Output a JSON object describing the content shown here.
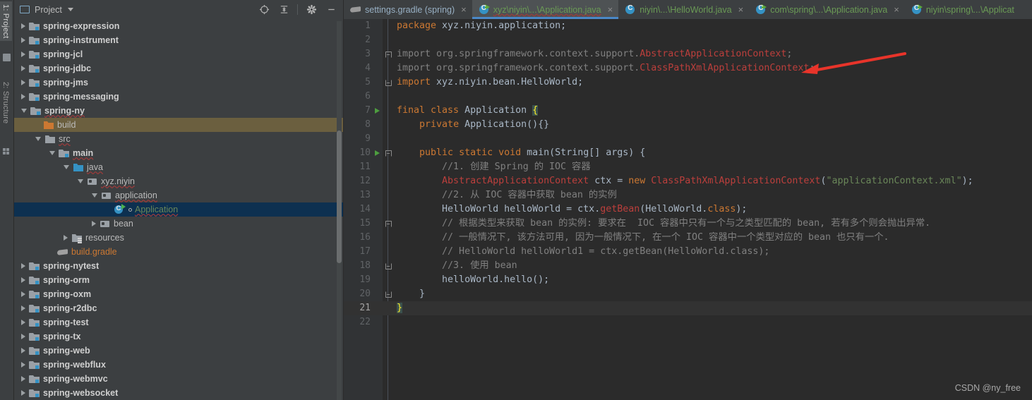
{
  "tool_strip": {
    "tabs": [
      {
        "label": "1: Project",
        "active": true
      },
      {
        "label": "2: Structure",
        "active": false
      }
    ]
  },
  "project_panel": {
    "title": "Project",
    "icons": [
      "monitor-icon",
      "chevron-down-icon",
      "locate-icon",
      "collapse-all-icon",
      "gear-icon",
      "minimize-icon"
    ],
    "tree": [
      {
        "label": "spring-expression",
        "indent": 1,
        "twist": "closed",
        "icon": "module-folder-icon",
        "style": "bold"
      },
      {
        "label": "spring-instrument",
        "indent": 1,
        "twist": "closed",
        "icon": "module-folder-icon",
        "style": "bold"
      },
      {
        "label": "spring-jcl",
        "indent": 1,
        "twist": "closed",
        "icon": "module-folder-icon",
        "style": "bold"
      },
      {
        "label": "spring-jdbc",
        "indent": 1,
        "twist": "closed",
        "icon": "module-folder-icon",
        "style": "bold"
      },
      {
        "label": "spring-jms",
        "indent": 1,
        "twist": "closed",
        "icon": "module-folder-icon",
        "style": "bold"
      },
      {
        "label": "spring-messaging",
        "indent": 1,
        "twist": "closed",
        "icon": "module-folder-icon",
        "style": "bold"
      },
      {
        "label": "spring-ny",
        "indent": 1,
        "twist": "open",
        "icon": "module-folder-icon",
        "style": "bold-squiggle"
      },
      {
        "label": "build",
        "indent": 2,
        "twist": "none",
        "icon": "orange-folder-icon",
        "style": "plain",
        "row_highlight": "build"
      },
      {
        "label": "src",
        "indent": 2,
        "twist": "open",
        "icon": "folder-icon",
        "style": "squiggle"
      },
      {
        "label": "main",
        "indent": 3,
        "twist": "open",
        "icon": "module-folder-icon",
        "style": "bold-squiggle"
      },
      {
        "label": "java",
        "indent": 4,
        "twist": "open",
        "icon": "blue-folder-icon",
        "style": "squiggle"
      },
      {
        "label": "xyz.niyin",
        "indent": 5,
        "twist": "open",
        "icon": "package-icon",
        "style": "squiggle"
      },
      {
        "label": "application",
        "indent": 6,
        "twist": "open",
        "icon": "package-icon",
        "style": "squiggle"
      },
      {
        "label": "Application",
        "indent": 7,
        "twist": "none",
        "icon": "java-class-run-icon",
        "style": "green-squiggle",
        "row_highlight": "selected"
      },
      {
        "label": "bean",
        "indent": 6,
        "twist": "closed",
        "icon": "package-icon",
        "style": "plain"
      },
      {
        "label": "resources",
        "indent": 4,
        "twist": "closed",
        "icon": "resources-folder-icon",
        "style": "plain"
      },
      {
        "label": "build.gradle",
        "indent": 3,
        "twist": "none",
        "icon": "gradle-icon",
        "style": "orange"
      },
      {
        "label": "spring-nytest",
        "indent": 1,
        "twist": "closed",
        "icon": "module-folder-icon",
        "style": "bold"
      },
      {
        "label": "spring-orm",
        "indent": 1,
        "twist": "closed",
        "icon": "module-folder-icon",
        "style": "bold"
      },
      {
        "label": "spring-oxm",
        "indent": 1,
        "twist": "closed",
        "icon": "module-folder-icon",
        "style": "bold"
      },
      {
        "label": "spring-r2dbc",
        "indent": 1,
        "twist": "closed",
        "icon": "module-folder-icon",
        "style": "bold"
      },
      {
        "label": "spring-test",
        "indent": 1,
        "twist": "closed",
        "icon": "module-folder-icon",
        "style": "bold"
      },
      {
        "label": "spring-tx",
        "indent": 1,
        "twist": "closed",
        "icon": "module-folder-icon",
        "style": "bold"
      },
      {
        "label": "spring-web",
        "indent": 1,
        "twist": "closed",
        "icon": "module-folder-icon",
        "style": "bold"
      },
      {
        "label": "spring-webflux",
        "indent": 1,
        "twist": "closed",
        "icon": "module-folder-icon",
        "style": "bold"
      },
      {
        "label": "spring-webmvc",
        "indent": 1,
        "twist": "closed",
        "icon": "module-folder-icon",
        "style": "bold"
      },
      {
        "label": "spring-websocket",
        "indent": 1,
        "twist": "closed",
        "icon": "module-folder-icon",
        "style": "bold"
      }
    ]
  },
  "editor_tabs": [
    {
      "label": "settings.gradle (spring)",
      "icon": "gradle-icon",
      "active": false,
      "color": "blue",
      "close": "×"
    },
    {
      "label": "xyz\\niyin\\...\\Application.java",
      "icon": "java-class-run-icon",
      "active": true,
      "color": "green",
      "wavy": true,
      "close": "×"
    },
    {
      "label": "niyin\\...\\HelloWorld.java",
      "icon": "java-class-icon",
      "active": false,
      "color": "green",
      "close": "×"
    },
    {
      "label": "com\\spring\\...\\Application.java",
      "icon": "java-class-run-icon",
      "active": false,
      "color": "green",
      "close": "×"
    },
    {
      "label": "niyin\\spring\\...\\Applicat",
      "icon": "java-class-run-icon",
      "active": false,
      "color": "green",
      "close": ""
    }
  ],
  "code": {
    "lines": [
      {
        "n": "1",
        "gutter_run": false,
        "fold": "",
        "tokens": [
          {
            "t": "package ",
            "c": "kw"
          },
          {
            "t": "xyz.niyin.application;",
            "c": "plain"
          }
        ]
      },
      {
        "n": "2",
        "gutter_run": false,
        "fold": "",
        "tokens": []
      },
      {
        "n": "3",
        "gutter_run": false,
        "fold": "top",
        "tokens": [
          {
            "t": "import ",
            "c": "cm"
          },
          {
            "t": "org.springframework.context.support.",
            "c": "cm"
          },
          {
            "t": "AbstractApplicationContext",
            "c": "err"
          },
          {
            "t": ";",
            "c": "cm"
          }
        ]
      },
      {
        "n": "4",
        "gutter_run": false,
        "fold": "",
        "tokens": [
          {
            "t": "import ",
            "c": "cm"
          },
          {
            "t": "org.springframework.context.support.",
            "c": "cm"
          },
          {
            "t": "ClassPathXmlApplicationContext",
            "c": "err"
          },
          {
            "t": ";",
            "c": "cm"
          }
        ]
      },
      {
        "n": "5",
        "gutter_run": false,
        "fold": "bot",
        "tokens": [
          {
            "t": "import ",
            "c": "kw"
          },
          {
            "t": "xyz.niyin.bean.HelloWorld;",
            "c": "plain"
          }
        ]
      },
      {
        "n": "6",
        "gutter_run": false,
        "fold": "",
        "tokens": []
      },
      {
        "n": "7",
        "gutter_run": true,
        "fold": "",
        "tokens": [
          {
            "t": "final class ",
            "c": "kw"
          },
          {
            "t": "Application ",
            "c": "cls2"
          },
          {
            "t": "{",
            "c": "brace-hl"
          }
        ]
      },
      {
        "n": "8",
        "gutter_run": false,
        "fold": "",
        "tokens": [
          {
            "t": "    ",
            "c": "plain"
          },
          {
            "t": "private ",
            "c": "kw"
          },
          {
            "t": "Application(){}",
            "c": "cls2"
          }
        ]
      },
      {
        "n": "9",
        "gutter_run": false,
        "fold": "",
        "tokens": []
      },
      {
        "n": "10",
        "gutter_run": true,
        "fold": "top",
        "tokens": [
          {
            "t": "    ",
            "c": "plain"
          },
          {
            "t": "public static void ",
            "c": "kw"
          },
          {
            "t": "main",
            "c": "mth2"
          },
          {
            "t": "(String[] args) {",
            "c": "cls2"
          }
        ]
      },
      {
        "n": "11",
        "gutter_run": false,
        "fold": "",
        "tokens": [
          {
            "t": "        //1. 创建 Spring 的 IOC 容器",
            "c": "cm"
          }
        ]
      },
      {
        "n": "12",
        "gutter_run": false,
        "fold": "",
        "tokens": [
          {
            "t": "        ",
            "c": "plain"
          },
          {
            "t": "AbstractApplicationContext",
            "c": "err"
          },
          {
            "t": " ctx = ",
            "c": "cls2"
          },
          {
            "t": "new ",
            "c": "kw"
          },
          {
            "t": "ClassPathXmlApplicationContext",
            "c": "err"
          },
          {
            "t": "(",
            "c": "cls2"
          },
          {
            "t": "\"applicationContext.xml\"",
            "c": "str"
          },
          {
            "t": ");",
            "c": "cls2"
          }
        ]
      },
      {
        "n": "13",
        "gutter_run": false,
        "fold": "",
        "tokens": [
          {
            "t": "        //2. 从 IOC 容器中获取 bean 的实例",
            "c": "cm"
          }
        ]
      },
      {
        "n": "14",
        "gutter_run": false,
        "fold": "",
        "tokens": [
          {
            "t": "        HelloWorld helloWorld = ctx.",
            "c": "cls2"
          },
          {
            "t": "getBean",
            "c": "err"
          },
          {
            "t": "(HelloWorld.",
            "c": "cls2"
          },
          {
            "t": "class",
            "c": "kw"
          },
          {
            "t": ");",
            "c": "cls2"
          }
        ]
      },
      {
        "n": "15",
        "gutter_run": false,
        "fold": "top",
        "tokens": [
          {
            "t": "        // 根据类型来获取 bean 的实例: 要求在  IOC 容器中只有一个与之类型匹配的 bean, 若有多个则会抛出异常.",
            "c": "cm"
          }
        ]
      },
      {
        "n": "16",
        "gutter_run": false,
        "fold": "",
        "tokens": [
          {
            "t": "        // 一般情况下, 该方法可用, 因为一般情况下, 在一个 IOC 容器中一个类型对应的 bean 也只有一个.",
            "c": "cm"
          }
        ]
      },
      {
        "n": "17",
        "gutter_run": false,
        "fold": "",
        "tokens": [
          {
            "t": "        // HelloWorld helloWorld1 = ctx.getBean(HelloWorld.class);",
            "c": "cm"
          }
        ]
      },
      {
        "n": "18",
        "gutter_run": false,
        "fold": "bot",
        "tokens": [
          {
            "t": "        //3. 使用 bean",
            "c": "cm"
          }
        ]
      },
      {
        "n": "19",
        "gutter_run": false,
        "fold": "",
        "tokens": [
          {
            "t": "        helloWorld.hello();",
            "c": "cls2"
          }
        ]
      },
      {
        "n": "20",
        "gutter_run": false,
        "fold": "bot",
        "tokens": [
          {
            "t": "    }",
            "c": "cls2"
          }
        ]
      },
      {
        "n": "21",
        "gutter_run": false,
        "fold": "",
        "caret": true,
        "tokens": [
          {
            "t": "}",
            "c": "brace-hl"
          }
        ]
      },
      {
        "n": "22",
        "gutter_run": false,
        "fold": "",
        "tokens": []
      }
    ]
  },
  "annotation": {
    "type": "red-arrow",
    "color": "#e8342a",
    "points_at_line": "3"
  },
  "watermark": "CSDN @ny_free",
  "colors": {
    "panel_bg": "#3c3f41",
    "editor_bg": "#2b2b2b",
    "gutter_bg": "#313335",
    "keyword": "#cc7832",
    "string": "#6a8759",
    "comment": "#808080",
    "error": "#bc3f3c",
    "method": "#ffc66d",
    "identifier": "#a9b7c6",
    "tab_active_underline": "#4a88c7",
    "selection": "#0d3050",
    "build_highlight": "#6b5f3f"
  }
}
